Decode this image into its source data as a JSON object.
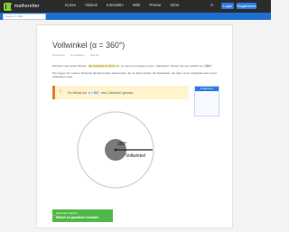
{
  "header": {
    "logo_text": "matheretter",
    "nav": [
      "Kurse",
      "Videos",
      "Interaktiv",
      "Wiki",
      "Preise",
      "Infos"
    ],
    "login_label": "Login",
    "register_label": "Registrieren"
  },
  "subheader": {
    "search_placeholder": "Suche im Wiki"
  },
  "article": {
    "title": "Vollwinkel (α = 360°)",
    "meta": [
      "Geometrie",
      "Grundlagen",
      "Aufrufe"
    ],
    "paragraph1_parts": [
      "Zeichnet man einen Winkel,",
      " der komplett im Kreis ",
      "ist, so nennt man diesen einen „Vollwinkel“. Dieser hat eine Größe von ",
      "360°",
      "."
    ],
    "paragraph2": "Hier liegen der andere Schenkel (Endschenkel) aufeinander. Es ist dass Gleiche der Nullwinkel, der dann einen Vollwinkel oder einen Vollwinkel meint.",
    "paragraph3": "",
    "warn_text_parts": [
      "Ein Winkel von ",
      "α = 360°",
      " wird „Vollwinkel“ genannt."
    ],
    "sidebox_title": "Programm"
  },
  "figure": {
    "angle_label": "360°",
    "name_label": "Vollwinkel"
  },
  "footer_box": {
    "line1": "Nächstes Kapitel:",
    "line2": "Winkel an parallelen Geraden"
  },
  "colors": {
    "green": "#51b848",
    "blue": "#2c7be5",
    "orange": "#e67e22",
    "warn_bg": "#fff4cc"
  }
}
